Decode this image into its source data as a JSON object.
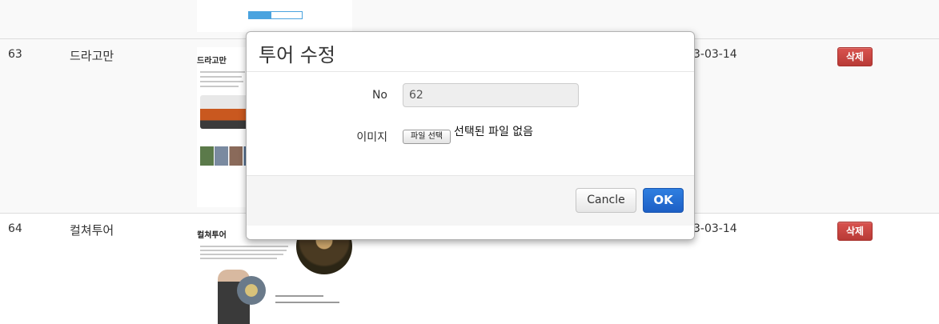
{
  "table": {
    "rows": [
      {
        "no": "63",
        "name": "드라고만",
        "date": "3-03-14",
        "delete_label": "삭제",
        "thumb_title": "드라고만"
      },
      {
        "no": "64",
        "name": "컬쳐투어",
        "date": "3-03-14",
        "delete_label": "삭제",
        "thumb_title": "컬쳐투어"
      }
    ]
  },
  "modal": {
    "title": "투어 수정",
    "fields": {
      "no_label": "No",
      "no_value": "62",
      "image_label": "이미지",
      "file_button": "파일 선택",
      "file_status": "선택된 파일 없음"
    },
    "cancel_label": "Cancle",
    "ok_label": "OK"
  }
}
